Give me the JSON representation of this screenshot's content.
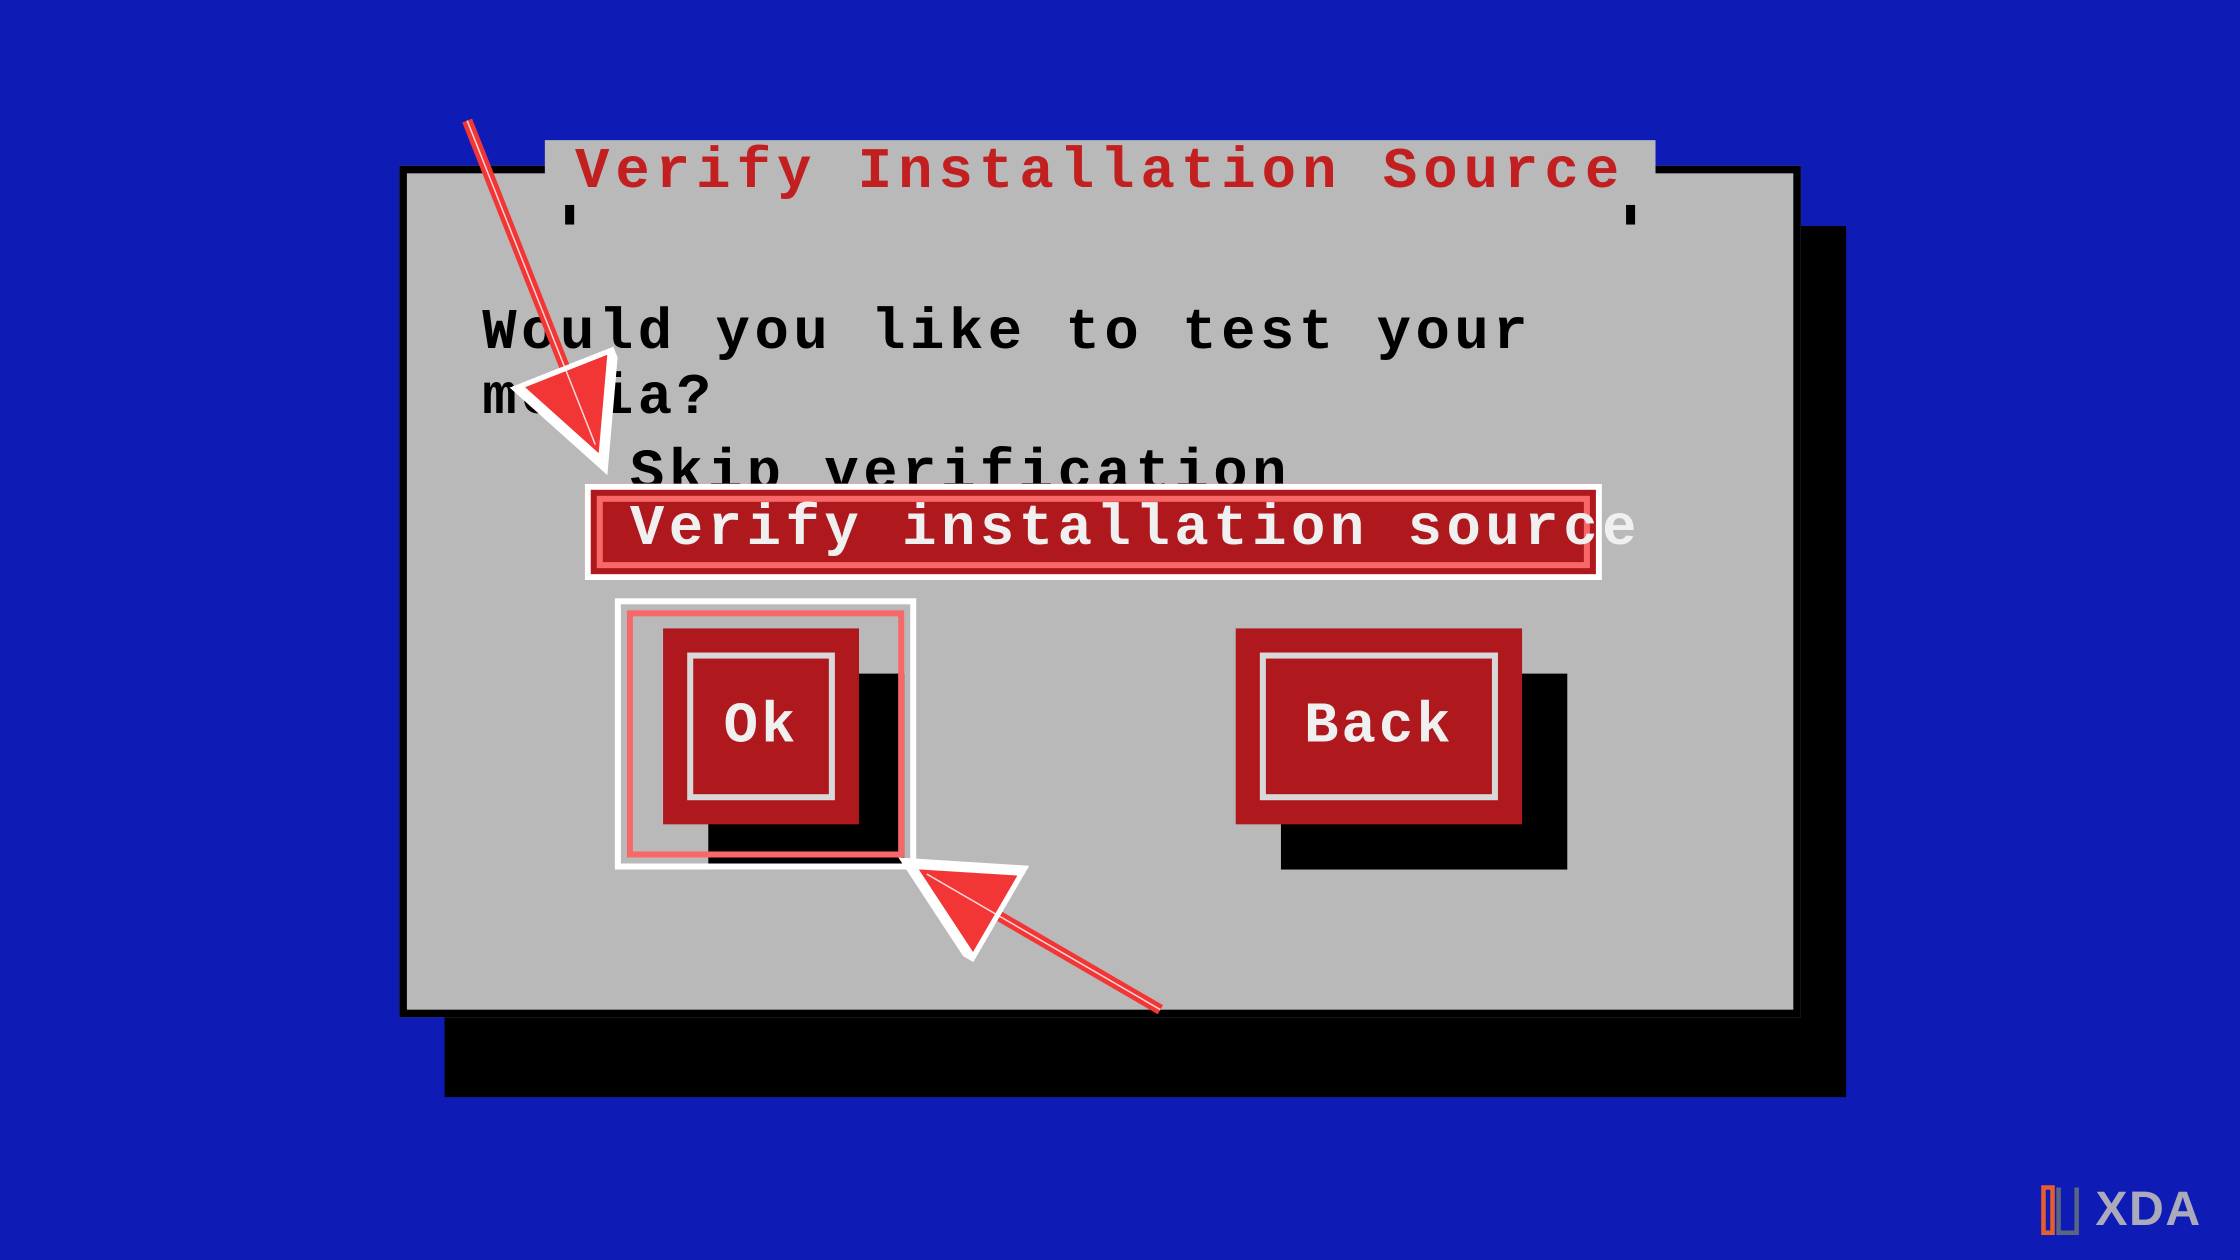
{
  "dialog": {
    "title": "Verify Installation Source",
    "prompt": "Would you like to test your media?",
    "options": {
      "skip": "Skip verification",
      "verify": "Verify installation source"
    },
    "buttons": {
      "ok": "Ok",
      "back": "Back"
    }
  },
  "watermark": {
    "text": "XDA"
  },
  "colors": {
    "background": "#0f1bb5",
    "dialog_bg": "#b9b9b9",
    "accent_red": "#af181d",
    "title_red": "#c22020",
    "highlight": "#f86868"
  }
}
